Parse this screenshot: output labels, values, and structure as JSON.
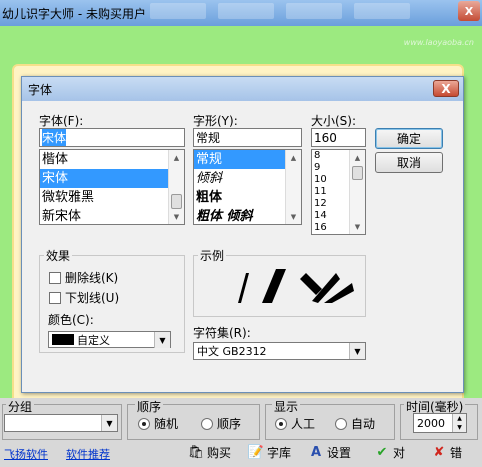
{
  "app": {
    "title": "幼儿识字大师 - 未购买用户",
    "close_symbol": "X",
    "brand_text": "www.laoyaoba.cn"
  },
  "dialog": {
    "title": "字体",
    "close_symbol": "X",
    "font_label": "字体(F):",
    "font_value": "宋体",
    "font_items": [
      "楷体",
      "宋体",
      "微软雅黑",
      "新宋体"
    ],
    "font_selected_index": 1,
    "style_label": "字形(Y):",
    "style_value": "常规",
    "style_items": [
      "常规",
      "倾斜",
      "粗体",
      "粗体 倾斜"
    ],
    "style_selected_index": 0,
    "size_label": "大小(S):",
    "size_value": "160",
    "size_items": [
      "8",
      "9",
      "10",
      "11",
      "12",
      "14",
      "16"
    ],
    "ok_label": "确定",
    "cancel_label": "取消",
    "effects_label": "效果",
    "strikeout_label": "删除线(K)",
    "underline_label": "下划线(U)",
    "color_label": "颜色(C):",
    "color_value": "自定义",
    "color_swatch": "#000000",
    "sample_label": "示例",
    "script_label": "字符集(R):",
    "script_value": "中文 GB2312"
  },
  "bottom": {
    "group_label": "分组",
    "order_label": "顺序",
    "order_random": "随机",
    "order_sequential": "顺序",
    "display_label": "显示",
    "display_manual": "人工",
    "display_auto": "自动",
    "timer_label": "时间(毫秒)",
    "timer_value": "2000",
    "link_feiyang": "飞扬软件",
    "link_recommend": "软件推荐",
    "btn_buy": "购买",
    "btn_library": "字库",
    "btn_settings": "设置",
    "btn_right": "对",
    "btn_wrong": "错"
  },
  "colors": {
    "green_bg": "#9cea80",
    "selection": "#3399ff"
  }
}
